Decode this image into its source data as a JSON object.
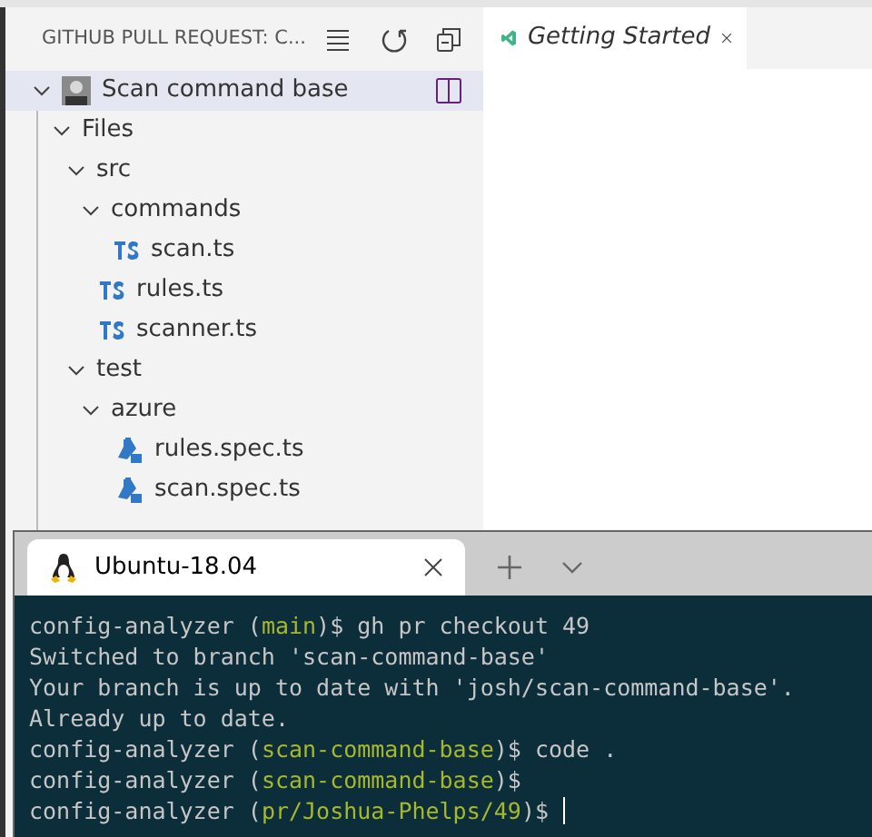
{
  "sidebar": {
    "title": "GITHUB PULL REQUEST: C...",
    "pull_request": {
      "title": "Scan command base",
      "expanded": true,
      "selected": true
    },
    "tree": [
      {
        "label": "Files",
        "kind": "folder",
        "expanded": true,
        "children": [
          {
            "label": "src",
            "kind": "folder",
            "expanded": true,
            "children": [
              {
                "label": "commands",
                "kind": "folder",
                "expanded": true,
                "children": [
                  {
                    "label": "scan.ts",
                    "kind": "ts"
                  }
                ]
              },
              {
                "label": "rules.ts",
                "kind": "ts"
              },
              {
                "label": "scanner.ts",
                "kind": "ts"
              }
            ]
          },
          {
            "label": "test",
            "kind": "folder",
            "expanded": true,
            "children": [
              {
                "label": "azure",
                "kind": "folder",
                "expanded": true,
                "children": [
                  {
                    "label": "rules.spec.ts",
                    "kind": "spec"
                  },
                  {
                    "label": "scan.spec.ts",
                    "kind": "spec"
                  }
                ]
              }
            ]
          }
        ]
      }
    ]
  },
  "editor": {
    "tabs": [
      {
        "label": "Getting Started",
        "selected": true
      }
    ]
  },
  "terminal": {
    "tabs": [
      {
        "label": "Ubuntu-18.04",
        "selected": true
      }
    ],
    "lines": [
      [
        {
          "text": "config-analyzer (",
          "kind": "plain"
        },
        {
          "text": "main",
          "kind": "branch"
        },
        {
          "text": ")$ gh pr checkout 49",
          "kind": "plain"
        }
      ],
      [
        {
          "text": "Switched to branch 'scan-command-base'",
          "kind": "plain"
        }
      ],
      [
        {
          "text": "Your branch is up to date with 'josh/scan-command-base'.",
          "kind": "plain"
        }
      ],
      [
        {
          "text": "Already up to date.",
          "kind": "plain"
        }
      ],
      [
        {
          "text": "config-analyzer (",
          "kind": "plain"
        },
        {
          "text": "scan-command-base",
          "kind": "branch"
        },
        {
          "text": ")$ code .",
          "kind": "plain"
        }
      ],
      [
        {
          "text": "config-analyzer (",
          "kind": "plain"
        },
        {
          "text": "scan-command-base",
          "kind": "branch"
        },
        {
          "text": ")$",
          "kind": "plain"
        }
      ],
      [
        {
          "text": "config-analyzer (",
          "kind": "plain"
        },
        {
          "text": "pr/Joshua-Phelps/49",
          "kind": "branch"
        },
        {
          "text": ")$",
          "kind": "plain"
        }
      ]
    ],
    "cursor": true
  }
}
